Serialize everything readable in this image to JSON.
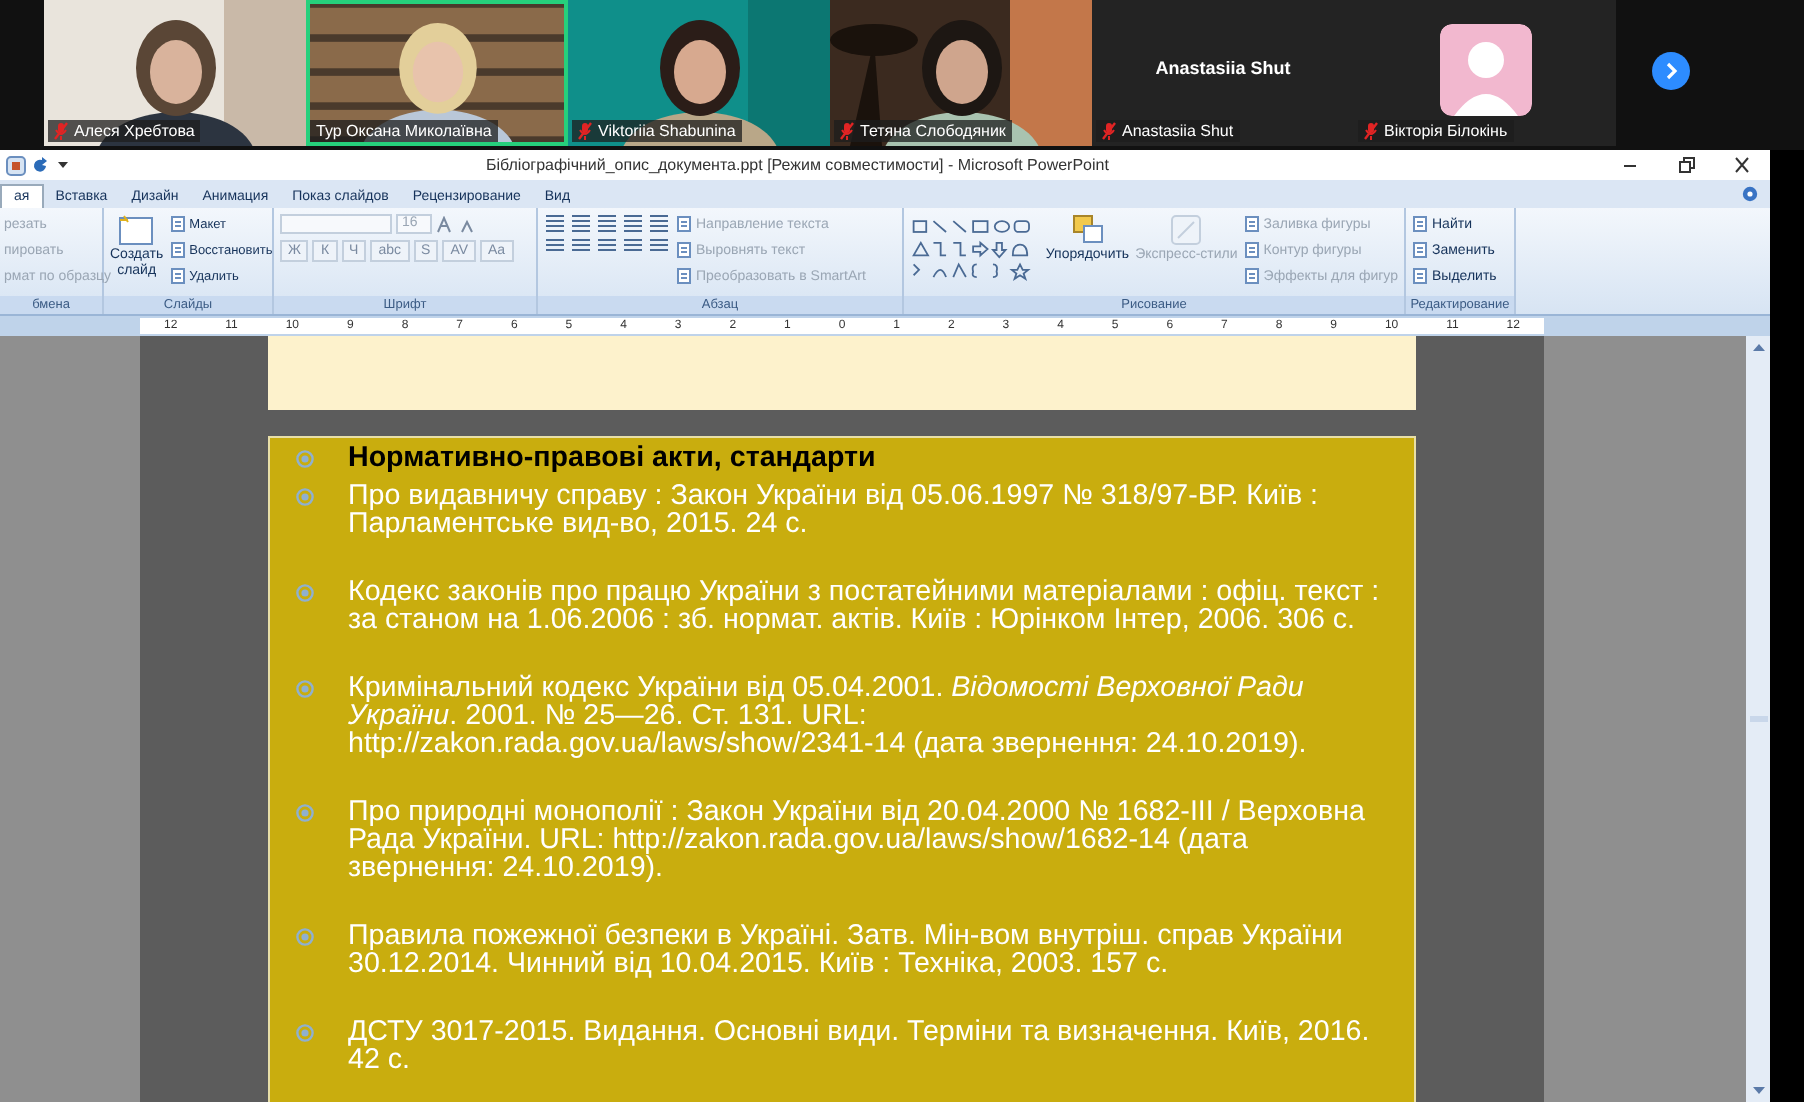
{
  "participants": [
    {
      "kind": "video",
      "name": "Алеся Хребтова",
      "muted": true,
      "speaking": false
    },
    {
      "kind": "video",
      "name": "Тур Оксана Миколаївна",
      "muted": false,
      "speaking": true
    },
    {
      "kind": "video",
      "name": "Viktoriia Shabunina",
      "muted": true,
      "speaking": false
    },
    {
      "kind": "video",
      "name": "Тетяна Слободяник",
      "muted": true,
      "speaking": false
    },
    {
      "kind": "name",
      "display_name": "Anastasiia Shut",
      "name": "Anastasiia Shut",
      "muted": true,
      "speaking": false
    },
    {
      "kind": "avatar",
      "name": "Вікторія Білокінь",
      "muted": true,
      "speaking": false
    }
  ],
  "window": {
    "title": "Бібліографічний_опис_документа.ppt [Режим совместимости] - Microsoft PowerPoint"
  },
  "tabs": [
    {
      "label": "ая",
      "selected": true
    },
    {
      "label": "Вставка",
      "selected": false
    },
    {
      "label": "Дизайн",
      "selected": false
    },
    {
      "label": "Анимация",
      "selected": false
    },
    {
      "label": "Показ слайдов",
      "selected": false
    },
    {
      "label": "Рецензирование",
      "selected": false
    },
    {
      "label": "Вид",
      "selected": false
    }
  ],
  "ribbon": {
    "groups": [
      {
        "kind": "clipboard",
        "label": "бмена",
        "small": [
          {
            "label": "резать",
            "disabled": true
          },
          {
            "label": "пировать",
            "disabled": true
          },
          {
            "label": "рмат по образцу",
            "disabled": true
          }
        ]
      },
      {
        "kind": "slides",
        "label": "Слайды",
        "large": [
          {
            "label": "Создать слайд",
            "disabled": false
          }
        ],
        "small": [
          {
            "label": "Макет",
            "disabled": false
          },
          {
            "label": "Восстановить",
            "disabled": false
          },
          {
            "label": "Удалить",
            "disabled": false
          }
        ]
      },
      {
        "kind": "font",
        "label": "Шрифт",
        "font_size": "16",
        "font_buttons": [
          "Ж",
          "К",
          "Ч",
          "abc",
          "S",
          "AV",
          "Aa"
        ]
      },
      {
        "kind": "paragraph",
        "label": "Абзац",
        "small": [
          {
            "label": "Направление текста",
            "disabled": true
          },
          {
            "label": "Выровнять текст",
            "disabled": true
          },
          {
            "label": "Преобразовать в SmartArt",
            "disabled": true
          }
        ]
      },
      {
        "kind": "drawing",
        "label": "Рисование",
        "large": [
          {
            "label": "Упорядочить",
            "disabled": false
          },
          {
            "label": "Экспресс-стили",
            "disabled": true
          }
        ],
        "small": [
          {
            "label": "Заливка фигуры",
            "disabled": true
          },
          {
            "label": "Контур фигуры",
            "disabled": true
          },
          {
            "label": "Эффекты для фигур",
            "disabled": true
          }
        ]
      },
      {
        "kind": "editing",
        "label": "Редактирование",
        "small": [
          {
            "label": "Найти",
            "disabled": false
          },
          {
            "label": "Заменить",
            "disabled": false
          },
          {
            "label": "Выделить",
            "disabled": false
          }
        ]
      }
    ]
  },
  "ruler": {
    "marks": [
      "12",
      "11",
      "10",
      "9",
      "8",
      "7",
      "6",
      "5",
      "4",
      "3",
      "2",
      "1",
      "0",
      "1",
      "2",
      "3",
      "4",
      "5",
      "6",
      "7",
      "8",
      "9",
      "10",
      "11",
      "12"
    ]
  },
  "slide": {
    "items": [
      {
        "kind": "heading",
        "text": "Нормативно-правові акти, стандарти"
      },
      {
        "kind": "entry",
        "text": "Про видавничу справу : Закон України від 05.06.1997 № 318/97-ВР. Київ : Парламентське вид-во, 2015. 24 с."
      },
      {
        "kind": "entry",
        "text": "Кодекс законів про працю України з постатейними матеріалами : офіц. текст : за станом на 1.06.2006 : зб. нормат. актів. Київ : Юрінком Інтер, 2006. 306 с."
      },
      {
        "kind": "entry",
        "text": "Кримінальний кодекс України від 05.04.2001. *Відомості Верховної Ради України*. 2001. № 25—26. Ст. 131. URL: http://zakon.rada.gov.ua/laws/show/2341-14 (дата звернення: 24.10.2019)."
      },
      {
        "kind": "entry",
        "text": "Про природні монополії : Закон України від 20.04.2000 № 1682-ІІІ / Верховна Рада України. URL: http://zakon.rada.gov.ua/laws/show/1682-14 (дата звернення: 24.10.2019)."
      },
      {
        "kind": "entry",
        "text": "Правила пожежної безпеки в Україні. Затв. Мін-вом внутріш. справ України 30.12.2014. Чинний від 10.04.2015. Київ : Техніка, 2003. 157 с."
      },
      {
        "kind": "entry",
        "text": "ДСТУ 3017-2015. Видання. Основні види. Терміни та визначення. Київ, 2016. 42 с."
      }
    ]
  }
}
